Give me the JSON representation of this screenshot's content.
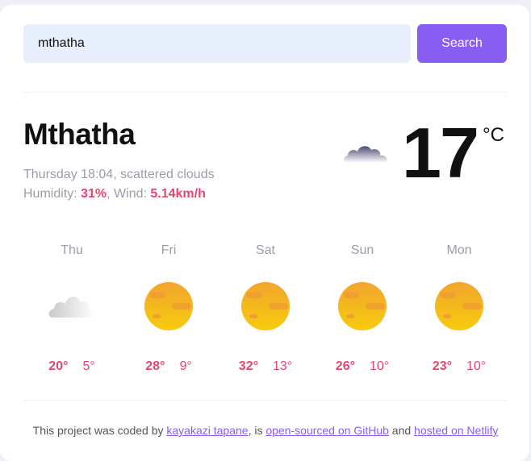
{
  "search": {
    "value": "mthatha",
    "placeholder": "",
    "button_label": "Search"
  },
  "current": {
    "city": "Mthatha",
    "datetime": "Thursday 18:04",
    "separator": ", ",
    "description": "scattered clouds",
    "humidity_label": "Humidity: ",
    "humidity_value": "31%",
    "wind_label": ", Wind: ",
    "wind_value": "5.14km/h",
    "temperature": "17",
    "unit": "°C",
    "icon": "scattered-clouds-icon"
  },
  "forecast": [
    {
      "day": "Thu",
      "max": "20°",
      "min": "5°",
      "icon": "cloud-icon"
    },
    {
      "day": "Fri",
      "max": "28°",
      "min": "9°",
      "icon": "sun-icon"
    },
    {
      "day": "Sat",
      "max": "32°",
      "min": "13°",
      "icon": "sun-icon"
    },
    {
      "day": "Sun",
      "max": "26°",
      "min": "10°",
      "icon": "sun-icon"
    },
    {
      "day": "Mon",
      "max": "23°",
      "min": "10°",
      "icon": "sun-icon"
    }
  ],
  "footer": {
    "prefix": "This project was coded by ",
    "author_link": "kayakazi tapane",
    "middle": ", is ",
    "github_link": "open-sourced on GitHub",
    "and_text": " and ",
    "netlify_link": "hosted on Netlify"
  },
  "colors": {
    "accent": "#885df1",
    "highlight": "#e7456f",
    "input_bg": "#e8effc",
    "muted": "#9c9ca8"
  }
}
